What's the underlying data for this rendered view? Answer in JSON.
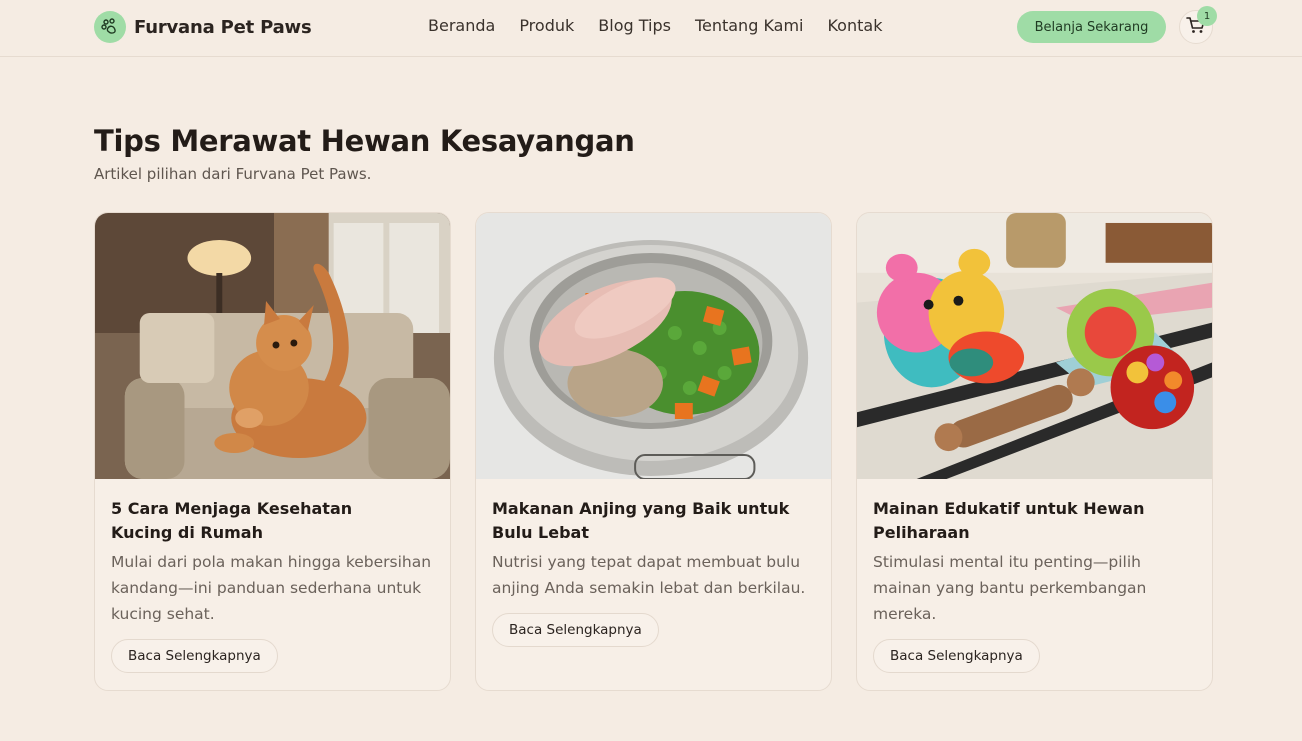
{
  "header": {
    "brand_name": "Furvana Pet Paws",
    "nav": [
      "Beranda",
      "Produk",
      "Blog Tips",
      "Tentang Kami",
      "Kontak"
    ],
    "cta_label": "Belanja Sekarang",
    "cart_count": "1",
    "accent_color": "#9fdca6"
  },
  "main": {
    "title": "Tips Merawat Hewan Kesayangan",
    "subtitle": "Artikel pilihan dari Furvana Pet Paws."
  },
  "articles": [
    {
      "image": "orange-cat-on-armchair",
      "title": "5 Cara Menjaga Kesehatan Kucing di Rumah",
      "excerpt": "Mulai dari pola makan hingga kebersihan kandang—ini panduan sederhana untuk kucing sehat.",
      "button": "Baca Selengkapnya"
    },
    {
      "image": "dog-food-bowl",
      "title": "Makanan Anjing yang Baik untuk Bulu Lebat",
      "excerpt": "Nutrisi yang tepat dapat membuat bulu anjing Anda semakin lebat dan berkilau.",
      "button": "Baca Selengkapnya"
    },
    {
      "image": "colorful-pet-toys",
      "title": "Mainan Edukatif untuk Hewan Peliharaan",
      "excerpt": "Stimulasi mental itu penting—pilih mainan yang bantu perkembangan mereka.",
      "button": "Baca Selengkapnya"
    }
  ]
}
